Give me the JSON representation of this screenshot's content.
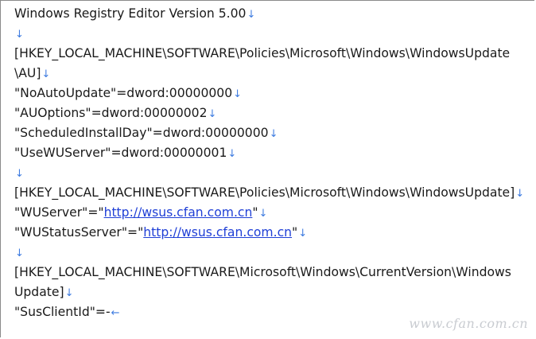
{
  "document": {
    "lines": [
      {
        "text": "Windows Registry Editor Version 5.00",
        "mark": "↓"
      },
      {
        "text": "",
        "mark": "↓"
      },
      {
        "text": "[HKEY_LOCAL_MACHINE\\SOFTWARE\\Policies\\Microsoft\\Windows\\WindowsUpdate",
        "mark": ""
      },
      {
        "text": "\\AU]",
        "mark": "↓"
      },
      {
        "text": "\"NoAutoUpdate\"=dword:00000000",
        "mark": "↓"
      },
      {
        "text": "\"AUOptions\"=dword:00000002",
        "mark": "↓"
      },
      {
        "text": "\"ScheduledInstallDay\"=dword:00000000",
        "mark": "↓"
      },
      {
        "text": "\"UseWUServer\"=dword:00000001",
        "mark": "↓"
      },
      {
        "text": "",
        "mark": "↓"
      },
      {
        "text": "[HKEY_LOCAL_MACHINE\\SOFTWARE\\Policies\\Microsoft\\Windows\\WindowsUpdate]",
        "mark": "↓"
      },
      {
        "pre": "\"WUServer\"=\"",
        "link": "http://wsus.cfan.com.cn",
        "post": "\"",
        "mark": "↓"
      },
      {
        "pre": "\"WUStatusServer\"=\"",
        "link": "http://wsus.cfan.com.cn",
        "post": "\"",
        "mark": "↓"
      },
      {
        "text": "",
        "mark": "↓"
      },
      {
        "text": "[HKEY_LOCAL_MACHINE\\SOFTWARE\\Microsoft\\Windows\\CurrentVersion\\Windows",
        "mark": ""
      },
      {
        "text": "Update]",
        "mark": "↓"
      },
      {
        "text": "\"SusClientId\"=-",
        "mark": "←"
      }
    ]
  },
  "watermark": "www.cfan.com.cn"
}
